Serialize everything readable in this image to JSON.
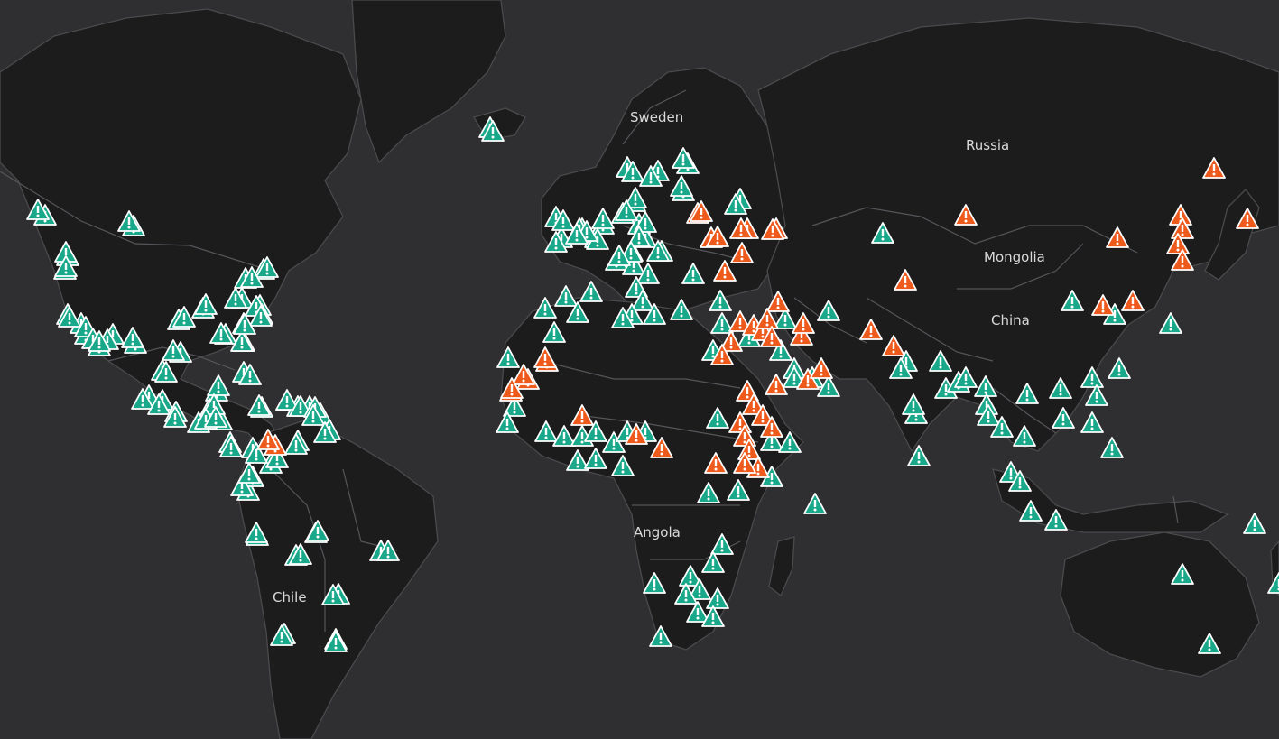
{
  "map": {
    "country_labels": [
      {
        "id": "sweden",
        "text": "Sweden"
      },
      {
        "id": "russia",
        "text": "Russia"
      },
      {
        "id": "mongolia",
        "text": "Mongolia"
      },
      {
        "id": "china",
        "text": "China"
      },
      {
        "id": "angola",
        "text": "Angola"
      },
      {
        "id": "chile",
        "text": "Chile"
      }
    ],
    "marker_icon": "warning-triangle-icon",
    "colors": {
      "ocean": "#2f2f31",
      "land": "#1c1c1d",
      "border": "#56565a",
      "green_marker": "#1aa88a",
      "orange_marker": "#ee5a1c",
      "label_text": "#d9d9d9"
    },
    "marker_counts": {
      "green": 225,
      "orange": 57
    }
  }
}
